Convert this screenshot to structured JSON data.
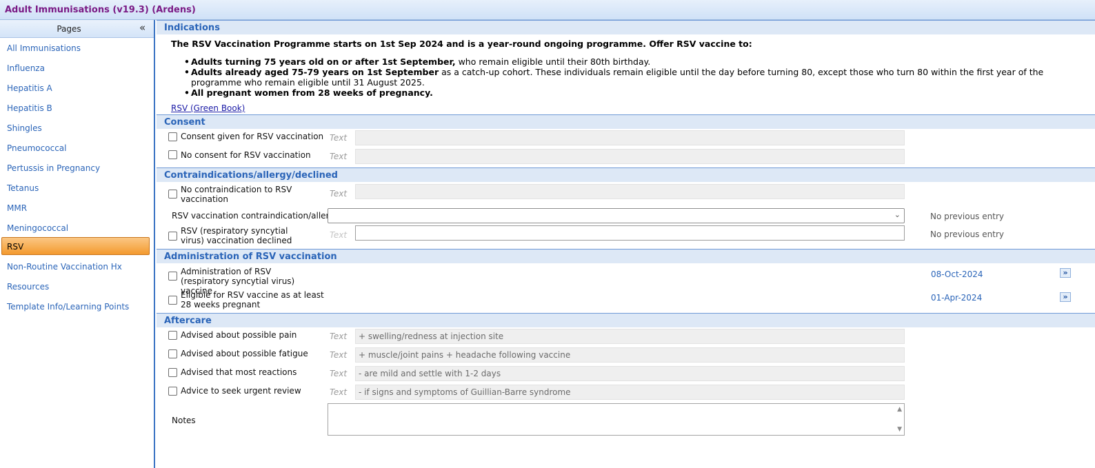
{
  "window": {
    "title": "Adult Immunisations (v19.3) (Ardens)"
  },
  "sidebar": {
    "header": "Pages",
    "collapse_glyph": "«",
    "items": [
      {
        "label": "All Immunisations"
      },
      {
        "label": "Influenza"
      },
      {
        "label": "Hepatitis A"
      },
      {
        "label": "Hepatitis B"
      },
      {
        "label": "Shingles"
      },
      {
        "label": "Pneumococcal"
      },
      {
        "label": "Pertussis in Pregnancy"
      },
      {
        "label": "Tetanus"
      },
      {
        "label": "MMR"
      },
      {
        "label": "Meningococcal"
      },
      {
        "label": "RSV",
        "active": true
      },
      {
        "label": "Non-Routine Vaccination Hx"
      },
      {
        "label": "Resources"
      },
      {
        "label": "Template Info/Learning Points"
      }
    ]
  },
  "indications": {
    "title": "Indications",
    "intro": "The RSV Vaccination Programme starts on 1st Sep 2024 and is a year-round ongoing programme. Offer RSV vaccine to:",
    "bullets": [
      {
        "bold": "Adults turning 75 years old on or after 1st September,",
        "rest": " who remain eligible until their 80th birthday."
      },
      {
        "bold": "Adults already aged 75-79 years on 1st September",
        "rest": " as a catch-up cohort. These individuals remain eligible until the day before turning 80, except those who turn 80 within the first year of the programme who remain eligible until 31 August 2025."
      },
      {
        "bold": "All pregnant women from 28 weeks of pregnancy.",
        "rest": ""
      }
    ],
    "link": "RSV (Green Book)"
  },
  "consent": {
    "title": "Consent",
    "rows": [
      {
        "label": "Consent given for RSV vaccination",
        "text_hint": "Text",
        "value": ""
      },
      {
        "label": "No consent for RSV vaccination",
        "text_hint": "Text",
        "value": ""
      }
    ]
  },
  "contra": {
    "title": "Contraindications/allergy/declined",
    "row1": {
      "label": "No contraindication to RSV vaccination",
      "text_hint": "Text",
      "value": ""
    },
    "select": {
      "label": "RSV vaccination contraindication/allergy",
      "value": "",
      "previous": "No previous entry"
    },
    "row3": {
      "label": "RSV (respiratory syncytial virus) vaccination declined",
      "text_hint": "Text",
      "value": "",
      "previous": "No previous entry"
    }
  },
  "admin": {
    "title": "Administration of RSV vaccination",
    "rows": [
      {
        "label": "Administration of RSV (respiratory syncytial virus) vaccine",
        "date": "08-Oct-2024",
        "button": "»"
      },
      {
        "label": "Eligible for RSV vaccine as at least 28 weeks pregnant",
        "date": "01-Apr-2024",
        "button": "»"
      }
    ]
  },
  "aftercare": {
    "title": "Aftercare",
    "rows": [
      {
        "label": "Advised about possible pain",
        "text_hint": "Text",
        "value": "+ swelling/redness at injection site"
      },
      {
        "label": "Advised about possible fatigue",
        "text_hint": "Text",
        "value": "+  muscle/joint pains + headache following vaccine"
      },
      {
        "label": "Advised that most reactions",
        "text_hint": "Text",
        "value": "- are mild and settle with 1-2 days"
      },
      {
        "label": "Advice to seek urgent review",
        "text_hint": "Text",
        "value": "- if signs and symptoms of Guillian-Barre syndrome"
      }
    ],
    "notes_label": "Notes",
    "notes_value": ""
  }
}
